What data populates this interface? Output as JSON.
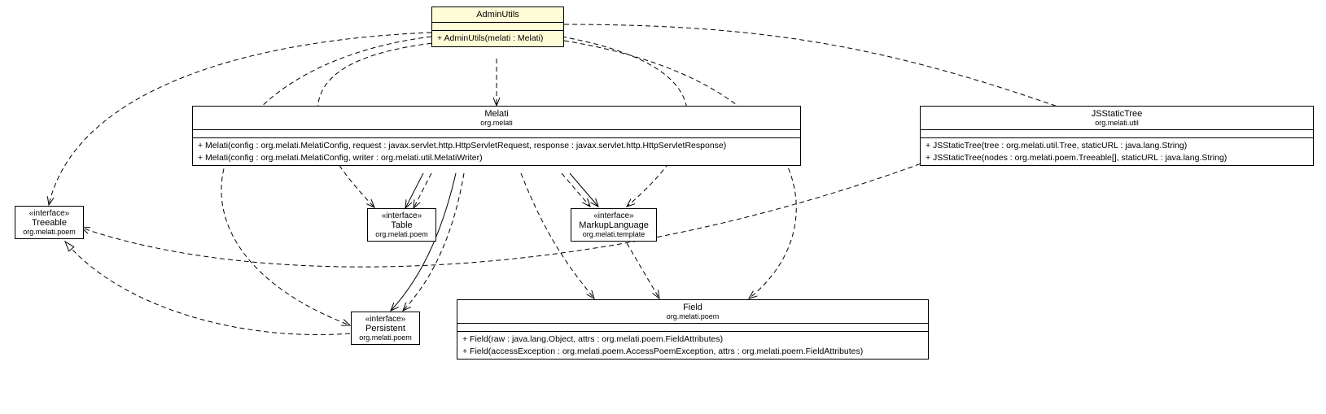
{
  "classes": {
    "adminUtils": {
      "name": "AdminUtils",
      "ops": [
        "+ AdminUtils(melati : Melati)"
      ]
    },
    "melati": {
      "name": "Melati",
      "pkg": "org.melati",
      "ops": [
        "+ Melati(config : org.melati.MelatiConfig, request : javax.servlet.http.HttpServletRequest, response : javax.servlet.http.HttpServletResponse)",
        "+ Melati(config : org.melati.MelatiConfig, writer : org.melati.util.MelatiWriter)"
      ]
    },
    "jsStaticTree": {
      "name": "JSStaticTree",
      "pkg": "org.melati.util",
      "ops": [
        "+ JSStaticTree(tree : org.melati.util.Tree, staticURL : java.lang.String)",
        "+ JSStaticTree(nodes : org.melati.poem.Treeable[], staticURL : java.lang.String)"
      ]
    },
    "treeable": {
      "stereo": "«interface»",
      "name": "Treeable",
      "pkg": "org.melati.poem"
    },
    "table": {
      "stereo": "«interface»",
      "name": "Table",
      "pkg": "org.melati.poem"
    },
    "markupLanguage": {
      "stereo": "«interface»",
      "name": "MarkupLanguage",
      "pkg": "org.melati.template"
    },
    "persistent": {
      "stereo": "«interface»",
      "name": "Persistent",
      "pkg": "org.melati.poem"
    },
    "field": {
      "name": "Field",
      "pkg": "org.melati.poem",
      "ops": [
        "+ Field(raw : java.lang.Object, attrs : org.melati.poem.FieldAttributes)",
        "+ Field(accessException : org.melati.poem.AccessPoemException, attrs : org.melati.poem.FieldAttributes)"
      ]
    }
  }
}
